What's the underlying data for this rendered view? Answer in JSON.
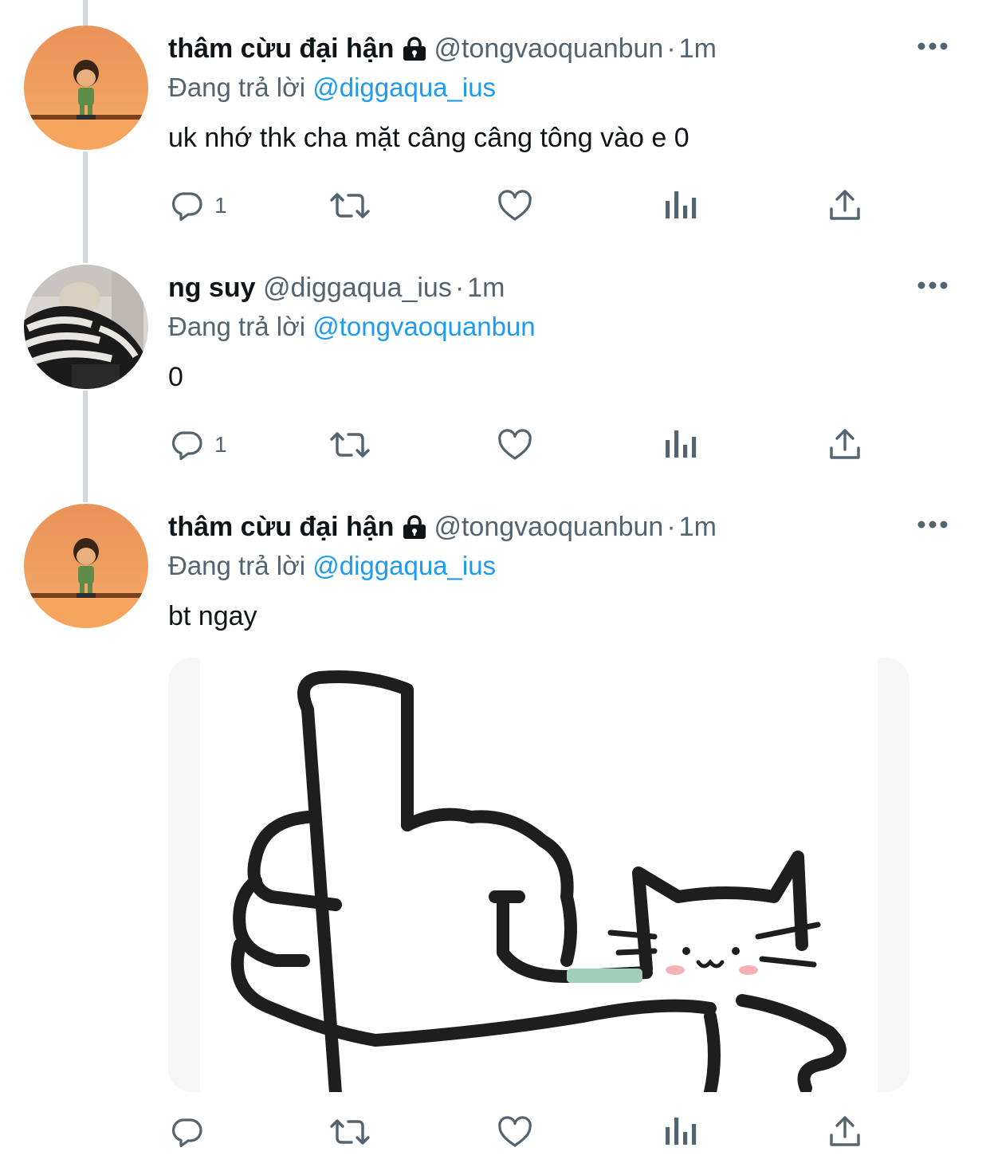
{
  "tweets": [
    {
      "display_name": "thâm cừu đại hận",
      "locked": true,
      "handle": "@tongvaoquanbun",
      "separator": "·",
      "time": "1m",
      "reply_prefix": "Đang trả lời",
      "reply_mention": "@diggaqua_ius",
      "text": "uk nhớ thk cha mặt câng câng tông vào e 0",
      "reply_count": "1",
      "avatar": "orange-toy-figure"
    },
    {
      "display_name": "ng suy",
      "locked": false,
      "handle": "@diggaqua_ius",
      "separator": "·",
      "time": "1m",
      "reply_prefix": "Đang trả lời",
      "reply_mention": "@tongvaoquanbun",
      "text": "0",
      "reply_count": "1",
      "avatar": "person-striped-sweater"
    },
    {
      "display_name": "thâm cừu đại hận",
      "locked": true,
      "handle": "@tongvaoquanbun",
      "separator": "·",
      "time": "1m",
      "reply_prefix": "Đang trả lời",
      "reply_mention": "@diggaqua_ius",
      "text": "bt ngay",
      "reply_count": "",
      "avatar": "orange-toy-figure",
      "media": "cat-middle-finger-drawing"
    }
  ],
  "icons": {
    "more": "more-horizontal-icon",
    "lock": "lock-icon",
    "reply": "reply-icon",
    "retweet": "retweet-icon",
    "like": "heart-icon",
    "views": "views-icon",
    "share": "share-icon"
  },
  "colors": {
    "text": "#0f1419",
    "secondary": "#536471",
    "mention": "#1d9bf0",
    "thread_line": "#cfd9de"
  }
}
